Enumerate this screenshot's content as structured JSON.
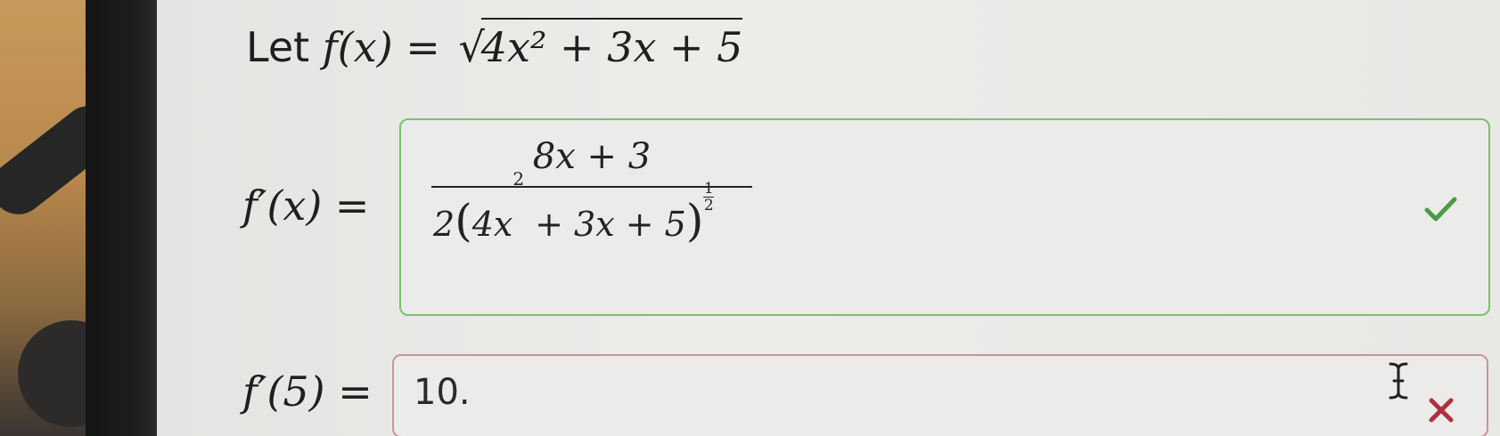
{
  "problem": {
    "let_word": "Let",
    "function_lhs": "f(x) =",
    "sqrt_symbol": "√",
    "radicand": "4x² + 3x + 5"
  },
  "derivative": {
    "label": "f′(x) =",
    "numerator": "8x + 3",
    "den_coef": "2",
    "den_open": "(",
    "den_base": "4x",
    "den_power": "2",
    "den_rest": " + 3x + 5",
    "den_close": ")",
    "exp_num": "1",
    "exp_den": "2",
    "status": "correct"
  },
  "evaluate": {
    "label": "f′(5) =",
    "input_value": "10.",
    "status": "incorrect"
  },
  "colors": {
    "correct": "#4a9a4a",
    "incorrect": "#b03040",
    "correct_border": "#7dbf6d",
    "incorrect_border": "#c9949a"
  },
  "icons": {
    "correct": "check-icon",
    "incorrect": "x-icon",
    "cursor": "text-cursor-icon"
  }
}
